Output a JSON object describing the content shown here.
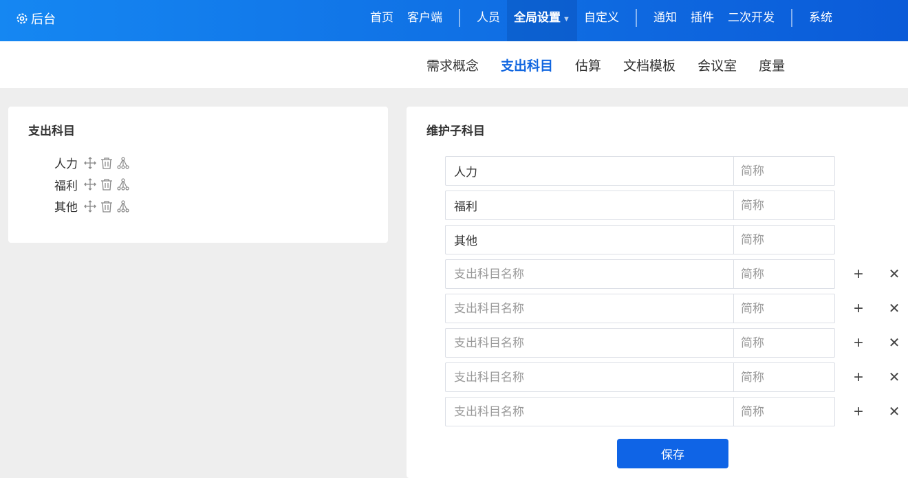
{
  "header": {
    "brand": "后台",
    "nav": [
      "首页",
      "客户端",
      "人员",
      "全局设置",
      "自定义",
      "通知",
      "插件",
      "二次开发",
      "系统"
    ]
  },
  "subnav": [
    "需求概念",
    "支出科目",
    "估算",
    "文档模板",
    "会议室",
    "度量"
  ],
  "left": {
    "title": "支出科目",
    "items": [
      "人力",
      "福利",
      "其他"
    ]
  },
  "right": {
    "title": "维护子科目",
    "rows": [
      {
        "name": "人力",
        "short": ""
      },
      {
        "name": "福利",
        "short": ""
      },
      {
        "name": "其他",
        "short": ""
      },
      {
        "name": "",
        "short": ""
      },
      {
        "name": "",
        "short": ""
      },
      {
        "name": "",
        "short": ""
      },
      {
        "name": "",
        "short": ""
      },
      {
        "name": "",
        "short": ""
      }
    ],
    "name_placeholder": "支出科目名称",
    "short_placeholder": "简称",
    "save": "保存"
  }
}
